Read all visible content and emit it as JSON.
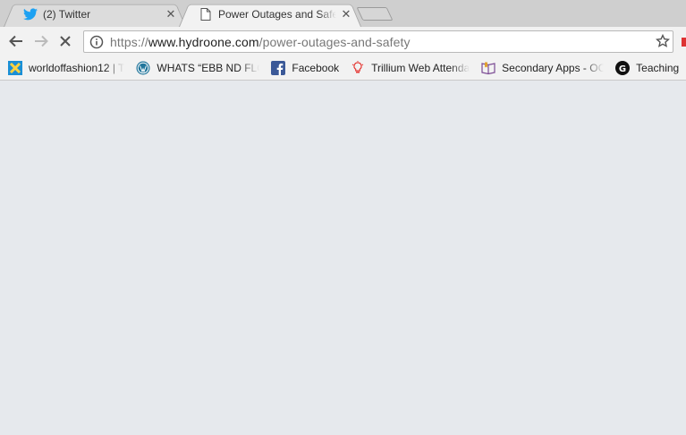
{
  "tabs": [
    {
      "title": "(2) Twitter",
      "icon": "twitter-bird-icon",
      "active": false
    },
    {
      "title": "Power Outages and Safety",
      "icon": "document-icon",
      "active": true
    }
  ],
  "toolbar": {
    "url_scheme": "https://",
    "url_host": "www.hydroone.com",
    "url_path": "/power-outages-and-safety"
  },
  "bookmarks": [
    {
      "label": "worldoffashion12 | T",
      "icon": "xwiki-icon"
    },
    {
      "label": "WHATS “EBB ND FLO",
      "icon": "wordpress-icon"
    },
    {
      "label": "Facebook",
      "icon": "facebook-icon"
    },
    {
      "label": "Trillium Web Attenda",
      "icon": "lightbulb-icon"
    },
    {
      "label": "Secondary Apps - OC",
      "icon": "book-icon"
    },
    {
      "label": "Teaching",
      "icon": "g-circle-icon"
    }
  ],
  "colors": {
    "twitter": "#1da1f2",
    "facebook": "#3b5998",
    "wordpress": "#21759b",
    "page_background": "#e6e9ed"
  }
}
